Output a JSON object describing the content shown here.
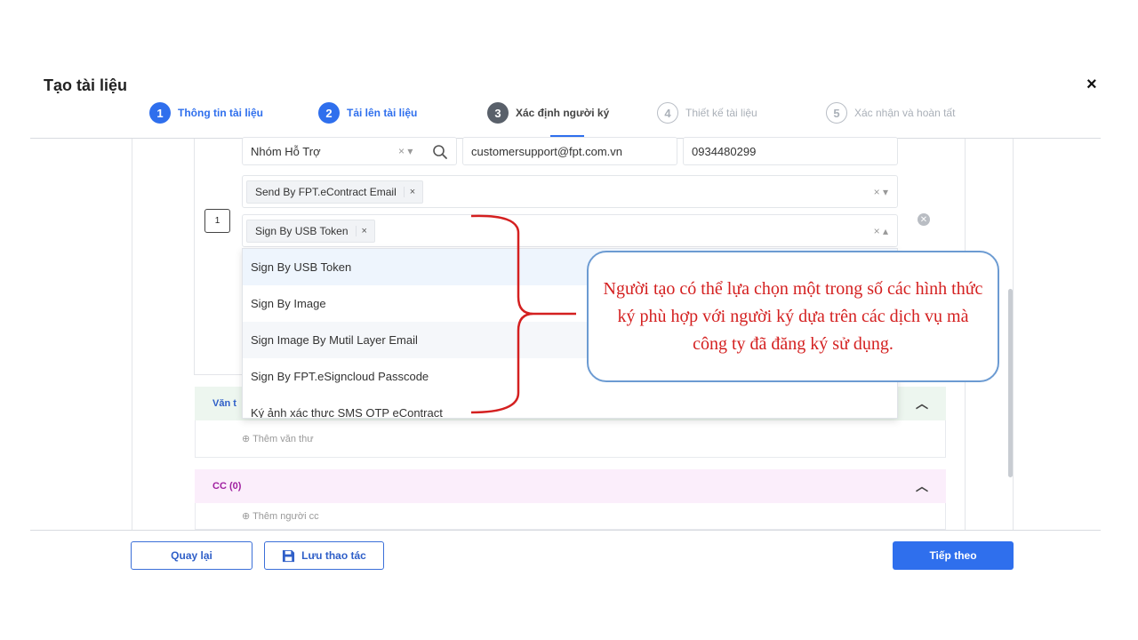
{
  "modal": {
    "title": "Tạo tài liệu",
    "close_icon": "×"
  },
  "steps": [
    {
      "num": "1",
      "label": "Thông tin tài liệu",
      "state": "done"
    },
    {
      "num": "2",
      "label": "Tải lên tài liệu",
      "state": "done"
    },
    {
      "num": "3",
      "label": "Xác định người ký",
      "state": "active"
    },
    {
      "num": "4",
      "label": "Thiết kế tài liệu",
      "state": "todo"
    },
    {
      "num": "5",
      "label": "Xác nhận và hoàn tất",
      "state": "todo"
    }
  ],
  "signer": {
    "order": "1",
    "name": "Nhóm Hỗ Trợ",
    "name_controls": "× ▾",
    "email": "customersupport@fpt.com.vn",
    "phone": "0934480299",
    "send_method_tag": "Send By FPT.eContract Email",
    "sign_method_tag": "Sign By USB Token",
    "tag_remove": "×",
    "send_controls": "×  ▾",
    "sign_controls": "×  ▴"
  },
  "dropdown": {
    "options": [
      "Sign By USB Token",
      "Sign By Image",
      "Sign Image By Mutil Layer Email",
      "Sign By FPT.eSigncloud Passcode",
      "Ký ảnh xác thực SMS OTP eContract"
    ]
  },
  "sections": {
    "clerk": {
      "title": "Văn t",
      "add_label": "Thêm văn thư"
    },
    "cc": {
      "title": "CC (0)",
      "add_label": "Thêm người cc"
    }
  },
  "callout": {
    "text": "Người tạo có thể lựa chọn một trong số các hình thức ký phù hợp với người ký dựa trên các dịch vụ mà công ty đã đăng ký sử dụng."
  },
  "footer": {
    "back_label": "Quay lại",
    "save_label": "Lưu thao tác",
    "next_label": "Tiếp theo"
  },
  "colors": {
    "accent": "#2f6fed",
    "annotation": "#d42020",
    "callout_border": "#6c9bd2",
    "clerk_header": "#edf6ef",
    "cc_header": "#fbeefb"
  },
  "icons": {
    "search": "search-icon",
    "save": "save-icon",
    "remove": "remove-signer-icon",
    "add": "plus-circle-icon",
    "chevron": "chevron-up-icon"
  }
}
